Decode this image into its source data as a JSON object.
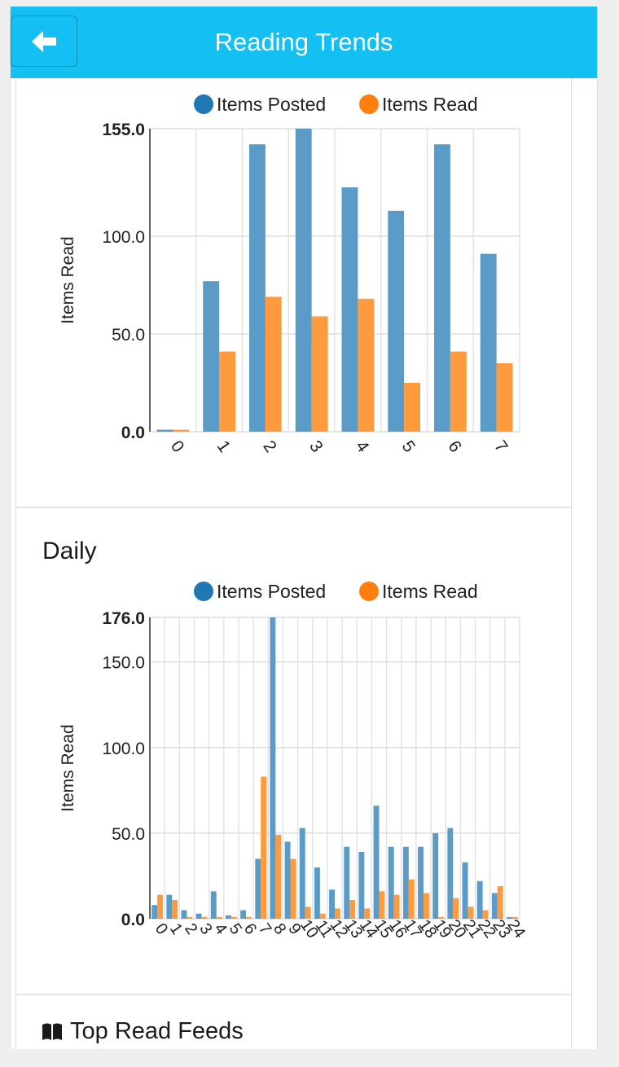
{
  "header": {
    "title": "Reading Trends",
    "back_icon": "arrow-left-icon"
  },
  "colors": {
    "posted": "#5a9bc8",
    "read": "#ff9a3d",
    "posted_legend": "#1f77b4",
    "read_legend": "#ff7f0e",
    "header": "#14c0f2"
  },
  "weekly": {
    "legend": {
      "posted": "Items Posted",
      "read": "Items Read"
    },
    "ylabel": "Items Read",
    "ytick_labels": [
      "0.0",
      "50.0",
      "100.0",
      "155.0"
    ]
  },
  "daily": {
    "section_title": "Daily",
    "legend": {
      "posted": "Items Posted",
      "read": "Items Read"
    },
    "ylabel": "Items Read",
    "ytick_labels": [
      "0.0",
      "50.0",
      "100.0",
      "150.0",
      "176.0"
    ]
  },
  "top_feeds": {
    "title": "Top Read Feeds",
    "icon": "book-icon"
  },
  "chart_data": [
    {
      "type": "bar",
      "categories": [
        "0",
        "1",
        "2",
        "3",
        "4",
        "5",
        "6",
        "7"
      ],
      "series": [
        {
          "name": "Items Posted",
          "values": [
            1,
            77,
            147,
            155,
            125,
            113,
            147,
            91
          ]
        },
        {
          "name": "Items Read",
          "values": [
            1,
            41,
            69,
            59,
            68,
            25,
            41,
            35
          ]
        }
      ],
      "ylabel": "Items Read",
      "ylim": [
        0,
        155
      ],
      "yticks": [
        0,
        50,
        100,
        155
      ],
      "grid": true,
      "legend": "top"
    },
    {
      "type": "bar",
      "title": "Daily",
      "categories": [
        "0",
        "1",
        "2",
        "3",
        "4",
        "5",
        "6",
        "7",
        "8",
        "9",
        "10",
        "11",
        "12",
        "13",
        "14",
        "15",
        "16",
        "17",
        "18",
        "19",
        "20",
        "21",
        "22",
        "23",
        "24"
      ],
      "series": [
        {
          "name": "Items Posted",
          "values": [
            8,
            14,
            5,
            3,
            16,
            2,
            5,
            35,
            176,
            45,
            53,
            30,
            17,
            42,
            39,
            66,
            42,
            42,
            42,
            50,
            53,
            33,
            22,
            15,
            1
          ]
        },
        {
          "name": "Items Read",
          "values": [
            14,
            11,
            1,
            1,
            1,
            1,
            1,
            83,
            49,
            35,
            7,
            3,
            6,
            11,
            6,
            16,
            14,
            23,
            15,
            1,
            12,
            7,
            5,
            19,
            1
          ]
        }
      ],
      "ylabel": "Items Read",
      "ylim": [
        0,
        176
      ],
      "yticks": [
        0,
        50,
        100,
        150,
        176
      ],
      "grid": true,
      "legend": "top"
    }
  ]
}
